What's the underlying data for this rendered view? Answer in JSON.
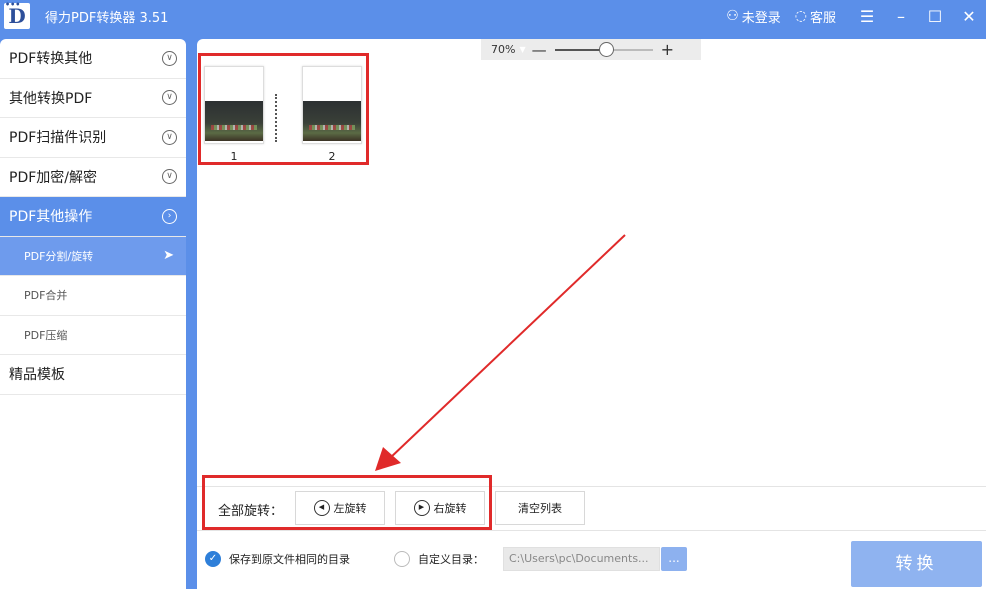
{
  "titlebar": {
    "app_title": "得力PDF转换器 3.51",
    "logo_letter": "D",
    "login_label": "未登录",
    "service_label": "客服",
    "menu_icon": "hamburger-icon",
    "minimize_icon": "minimize-icon",
    "maximize_icon": "maximize-icon",
    "close_icon": "close-icon"
  },
  "sidebar": {
    "items": [
      {
        "label": "PDF转换其他"
      },
      {
        "label": "其他转换PDF"
      },
      {
        "label": "PDF扫描件识别"
      },
      {
        "label": "PDF加密/解密"
      },
      {
        "label": "PDF其他操作"
      }
    ],
    "sub_items": [
      {
        "label": "PDF分割/旋转"
      },
      {
        "label": "PDF合并"
      },
      {
        "label": "PDF压缩"
      }
    ],
    "template_label": "精品模板"
  },
  "zoom": {
    "level": "70%",
    "minus": "—",
    "plus": "+"
  },
  "thumbnails": [
    {
      "page": "1"
    },
    {
      "page": "2"
    }
  ],
  "rotate": {
    "all_label": "全部旋转：",
    "left_label": "左旋转",
    "right_label": "右旋转",
    "clear_label": "清空列表"
  },
  "output": {
    "same_dir_label": "保存到原文件相同的目录",
    "custom_dir_label": "自定义目录：",
    "path_value": "C:\\Users\\pc\\Documents...",
    "browse_label": "...",
    "convert_label": "转换"
  },
  "colors": {
    "accent": "#5b8fe9",
    "highlight_box": "#e02a2a"
  }
}
